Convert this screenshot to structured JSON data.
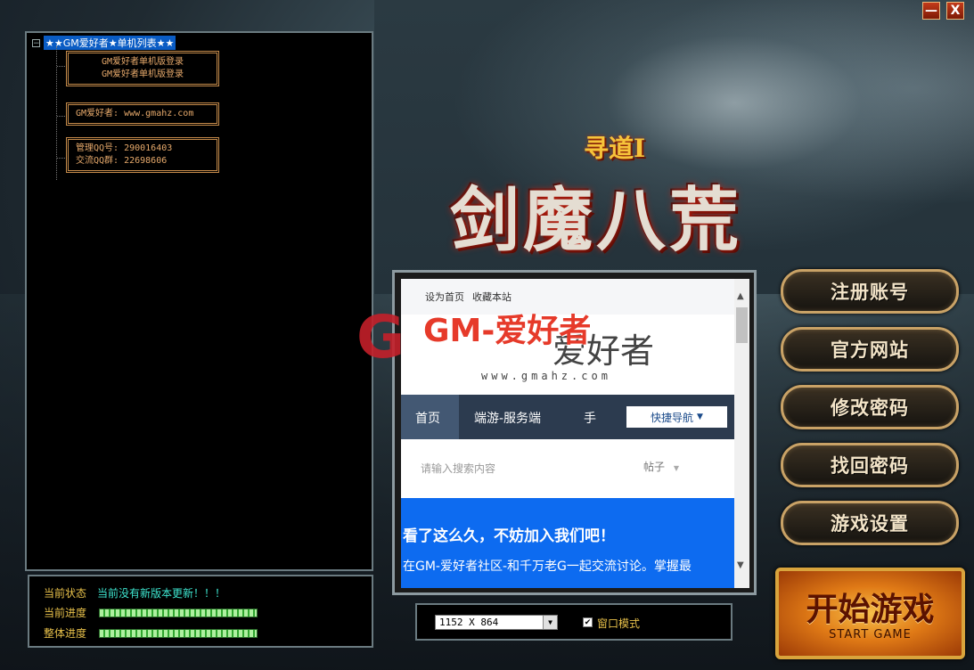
{
  "window": {
    "minimize_glyph": "—",
    "close_glyph": "X"
  },
  "tree": {
    "toggle_glyph": "−",
    "root_label": "★★GM爱好者★单机列表★★",
    "boxes": [
      [
        "GM爱好者单机版登录",
        "GM爱好者单机版登录"
      ],
      [
        "GM爱好者: www.gmahz.com"
      ],
      [
        "管理QQ号: 290016403",
        "交流QQ群: 22698606"
      ]
    ]
  },
  "status": {
    "state_label": "当前状态",
    "state_value": "当前没有新版本更新！！！",
    "current_progress_label": "当前进度",
    "overall_progress_label": "整体进度",
    "current_progress": 100,
    "overall_progress": 100
  },
  "logo": {
    "subtitle": "寻道Ⅰ",
    "title": "剑魔八荒"
  },
  "browser": {
    "top_link_1": "设为首页",
    "top_link_2": "收藏本站",
    "logo_text": "爱好者",
    "logo_url": "www.gmahz.com",
    "nav_home": "首页",
    "nav_item_2": "端游-服务端",
    "nav_item_3": "手",
    "quick_nav": "快捷导航",
    "search_placeholder": "请输入搜索内容",
    "search_type": "帖子",
    "banner_title": "看了这么久，不妨加入我们吧！",
    "banner_sub": "在GM-爱好者社区-和千万老G一起交流讨论。掌握最"
  },
  "watermark": {
    "g": "G",
    "text": "GM-爱好者",
    "url": "www.gmahz.com"
  },
  "resolution": {
    "value": "1152 X 864",
    "window_mode_label": "窗口模式",
    "window_mode_checked": true
  },
  "menu": {
    "register": "注册账号",
    "official_site": "官方网站",
    "change_password": "修改密码",
    "recover_password": "找回密码",
    "game_settings": "游戏设置"
  },
  "start": {
    "label_cn": "开始游戏",
    "label_en": "START GAME"
  },
  "colors": {
    "accent_gold": "#c9a266",
    "status_value": "#3ee6d0",
    "label_yellow": "#e7c04a",
    "banner_blue": "#0d6bf0"
  }
}
